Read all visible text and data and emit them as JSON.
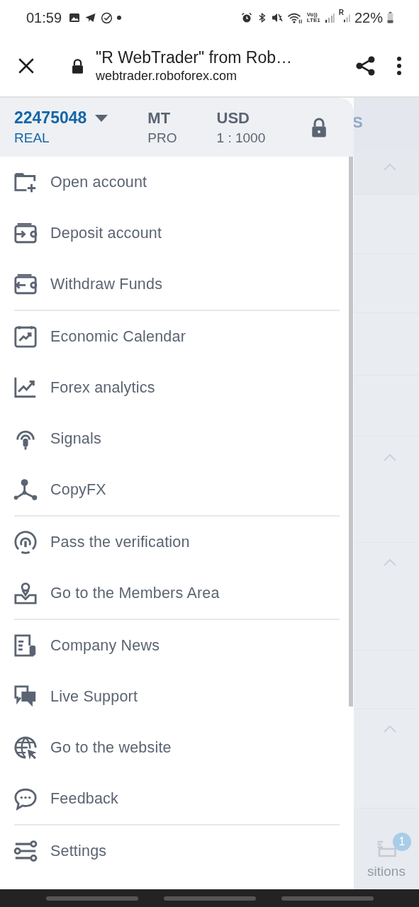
{
  "status_bar": {
    "time": "01:59",
    "volte": "Vo))",
    "lte": "LTE1",
    "roaming": "R",
    "battery": "22%"
  },
  "browser": {
    "title": "\"R WebTrader\" from Rob…",
    "url": "webtrader.roboforex.com"
  },
  "account": {
    "number": "22475048",
    "type": "REAL",
    "platform": "MT",
    "platform_edition": "PRO",
    "currency": "USD",
    "leverage": "1 : 1000"
  },
  "menu_sections": [
    {
      "items": [
        {
          "label": "Open account"
        },
        {
          "label": "Deposit account"
        },
        {
          "label": "Withdraw Funds"
        }
      ]
    },
    {
      "items": [
        {
          "label": "Economic Calendar"
        },
        {
          "label": "Forex analytics"
        },
        {
          "label": "Signals"
        },
        {
          "label": "CopyFX"
        }
      ]
    },
    {
      "items": [
        {
          "label": "Pass the verification"
        },
        {
          "label": "Go to the Members Area"
        }
      ]
    },
    {
      "items": [
        {
          "label": "Company News"
        },
        {
          "label": "Live Support"
        },
        {
          "label": "Go to the website"
        },
        {
          "label": "Feedback"
        }
      ]
    },
    {
      "items": [
        {
          "label": "Settings"
        }
      ]
    }
  ],
  "background": {
    "tab_fragment": "S",
    "nav_fragment": "sitions",
    "badge": "1"
  }
}
